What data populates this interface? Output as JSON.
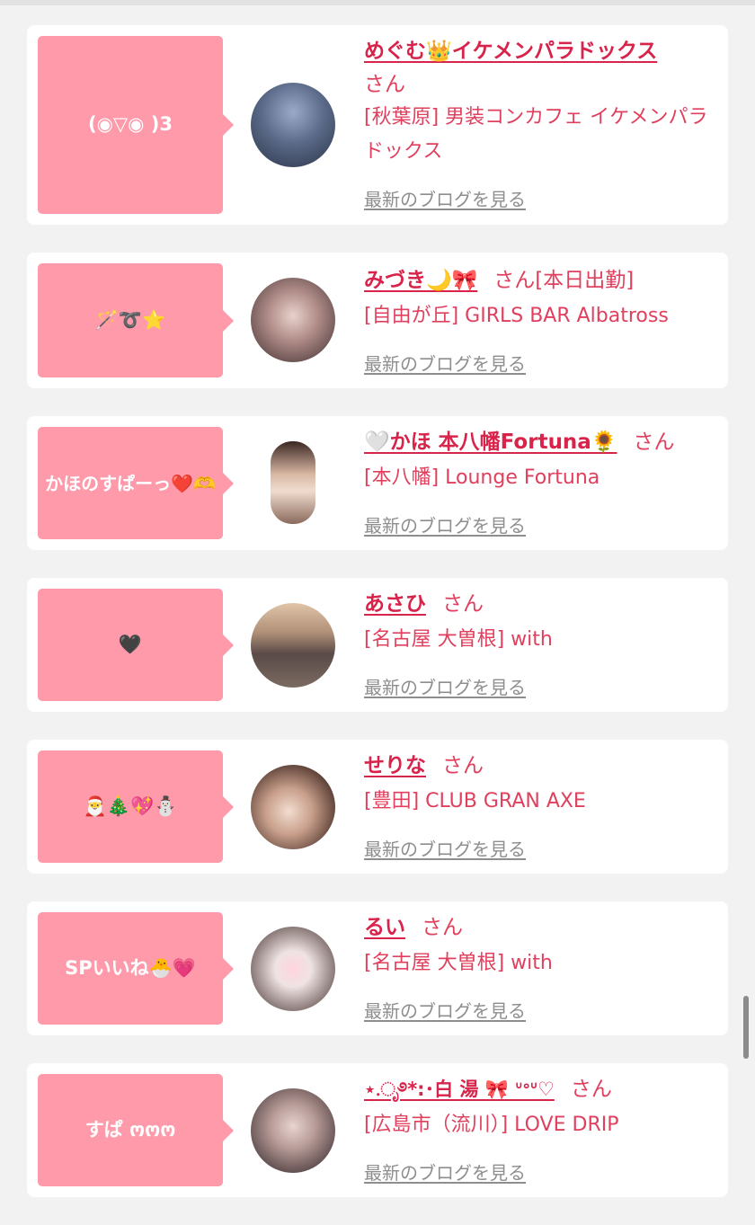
{
  "entries": [
    {
      "bubble": "(◉▽◉ )3",
      "name": "めぐむ👑イケメンパラドックス",
      "suffix": "さん",
      "shop": "[秋葉原] 男装コンカフェ イケメンパラドックス",
      "link": "最新のブログを見る",
      "avatar_colors": [
        "#3a4a66",
        "#9aaac8"
      ]
    },
    {
      "bubble": "🪄➰⭐",
      "name": "みづき🌙🎀",
      "suffix": "さん[本日出勤]",
      "shop": "[自由が丘] GIRLS BAR Albatross",
      "link": "最新のブログを見る",
      "avatar_colors": [
        "#4a3a3e",
        "#c9a6a4"
      ]
    },
    {
      "bubble": "かほのすぱーっ❤️🫶",
      "name": "🤍かほ 本八幡Fortuna🌻",
      "suffix": "さん",
      "shop": "[本八幡] Lounge Fortuna",
      "link": "最新のブログを見る",
      "avatar_colors": [
        "#6e4a3c",
        "#d9b8a4"
      ]
    },
    {
      "bubble": "🖤",
      "name": "あさひ",
      "suffix": "さん",
      "shop": "[名古屋 大曽根] with",
      "link": "最新のブログを見る",
      "avatar_colors": [
        "#5a4a48",
        "#b59a86"
      ]
    },
    {
      "bubble": "🎅🎄💖⛄",
      "name": "せりな",
      "suffix": "さん",
      "shop": "[豊田] CLUB GRAN AXE",
      "link": "最新のブログを見る",
      "avatar_colors": [
        "#4a3028",
        "#e3c7b4"
      ]
    },
    {
      "bubble": "SPいいね🐣💗",
      "name": "るい",
      "suffix": "さん",
      "shop": "[名古屋 大曽根] with",
      "link": "最新のブログを見る",
      "avatar_colors": [
        "#5b4a4a",
        "#efe3e3"
      ]
    },
    {
      "bubble": "すぱ ოოო",
      "name": "⋆.ೃ࿔*:･白 湯 🎀 ᐡᐤᐡ♡",
      "suffix": "さん",
      "shop": "[広島市（流川）] LOVE DRIP",
      "link": "最新のブログを見る",
      "avatar_colors": [
        "#4a3a3c",
        "#d9c2c0"
      ]
    }
  ]
}
